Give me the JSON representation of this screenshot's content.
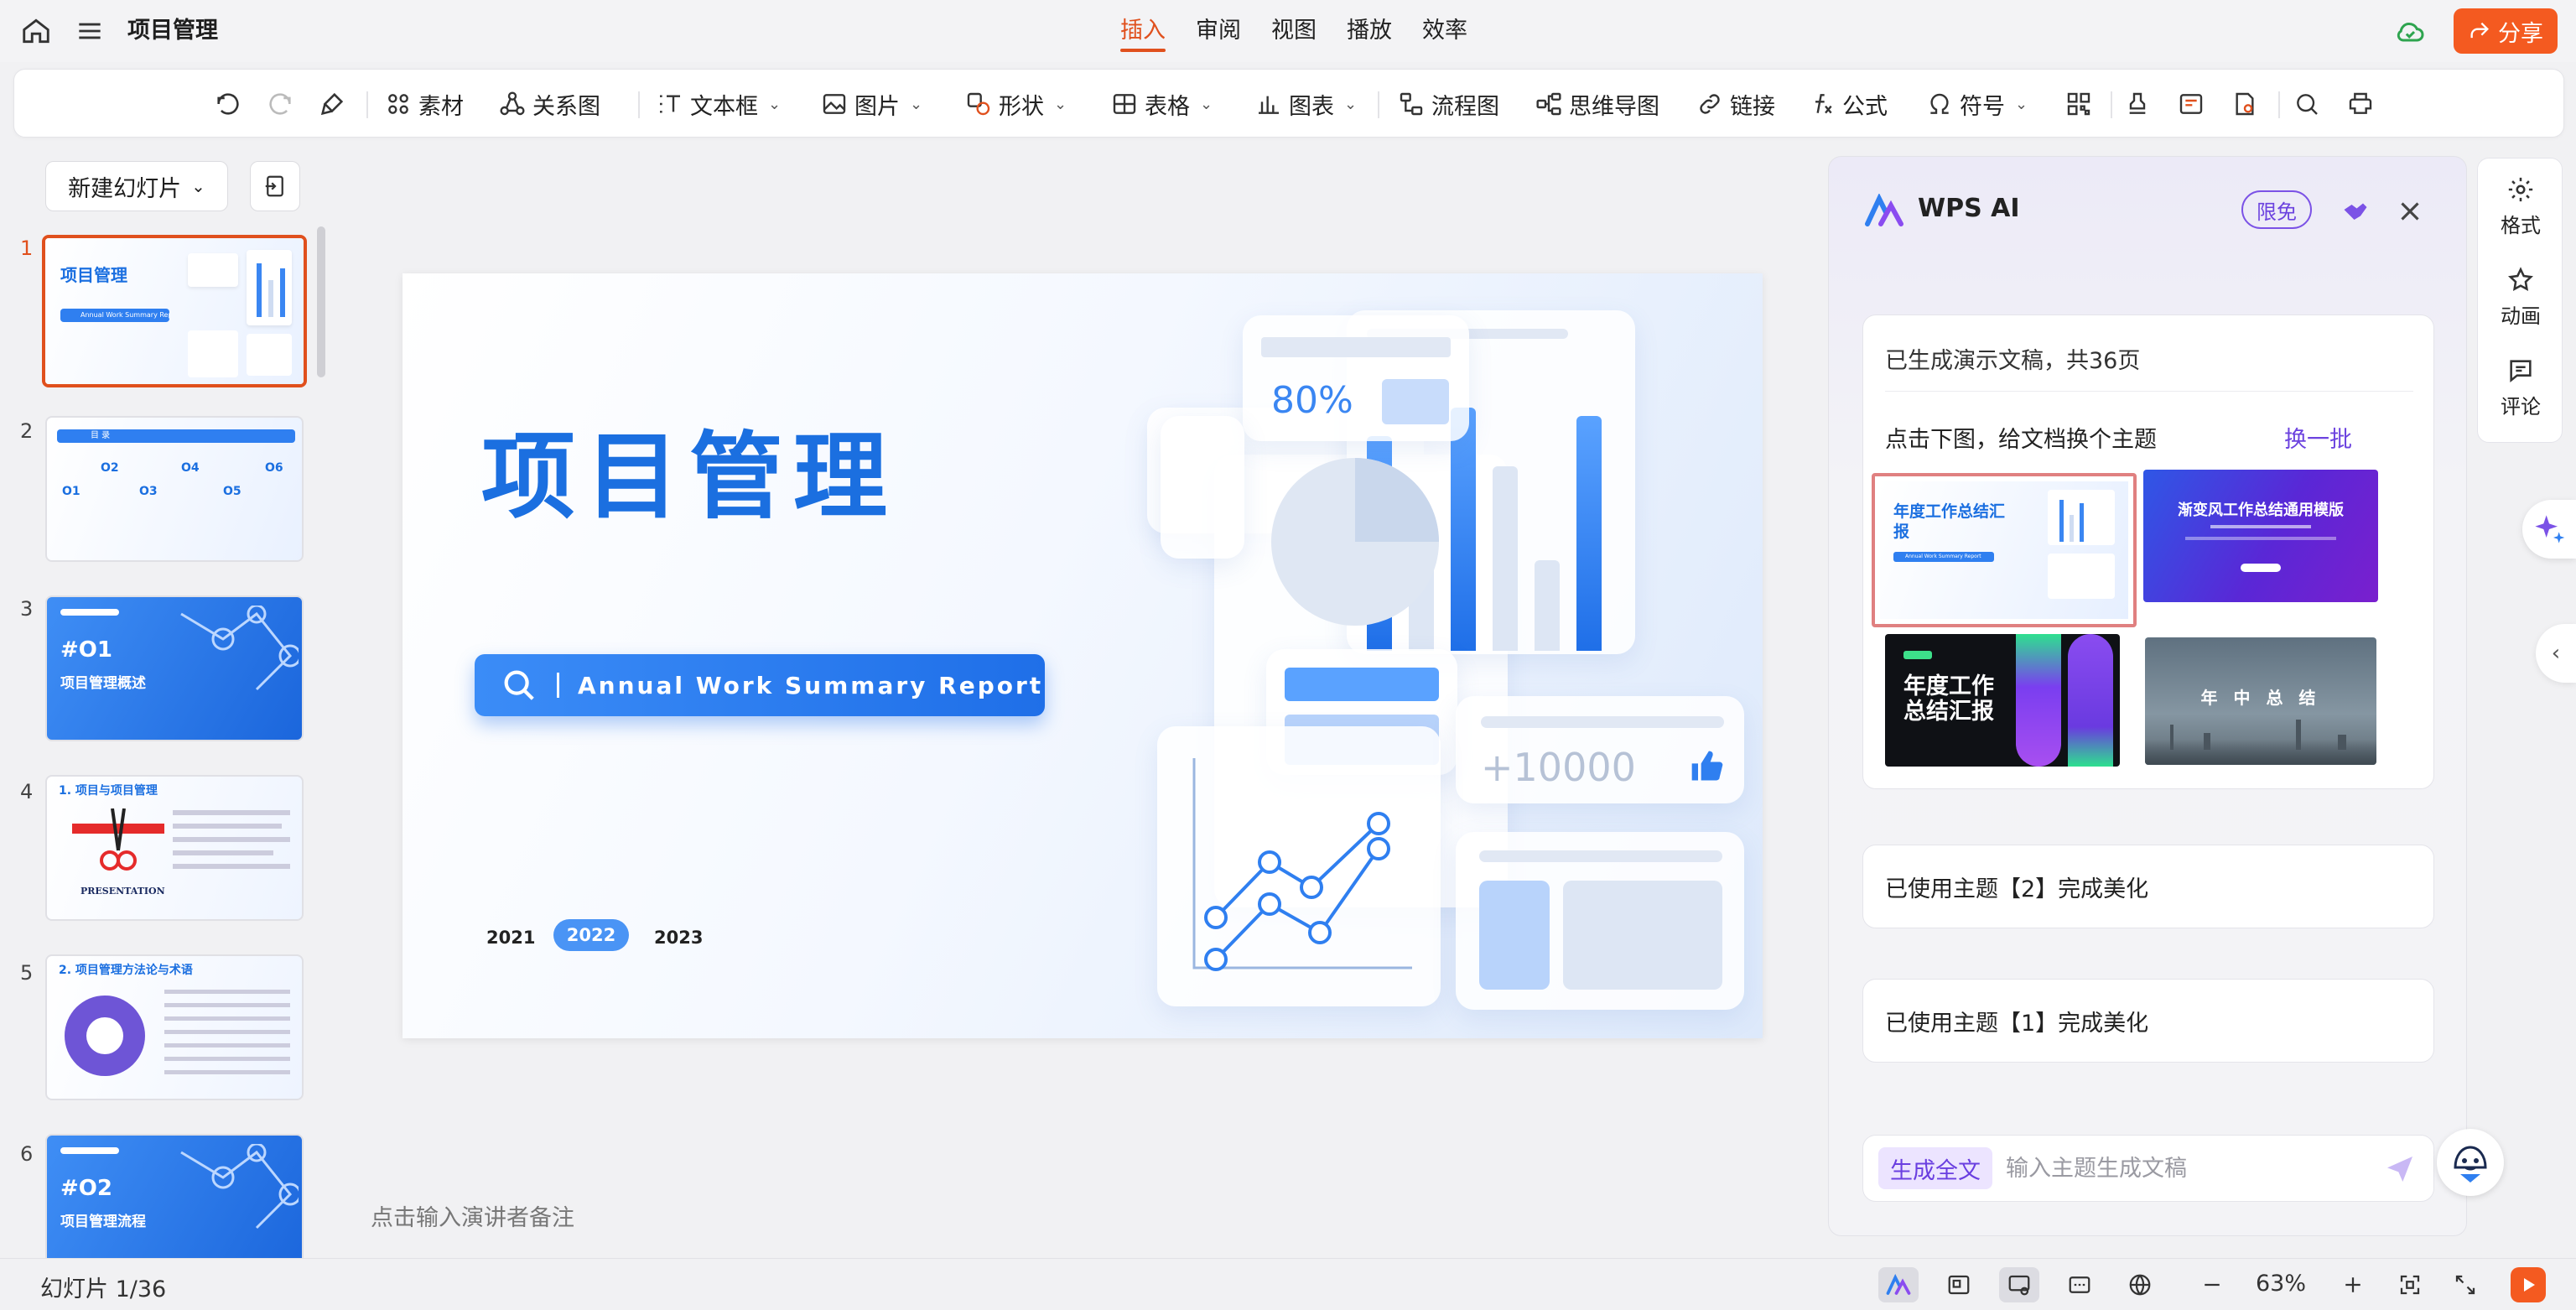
{
  "titlebar": {
    "doc_title": "项目管理",
    "tabs": [
      {
        "label": "插入",
        "active": true
      },
      {
        "label": "审阅",
        "active": false
      },
      {
        "label": "视图",
        "active": false
      },
      {
        "label": "播放",
        "active": false
      },
      {
        "label": "效率",
        "active": false
      }
    ],
    "share_label": "分享"
  },
  "ribbon": {
    "material": "素材",
    "relation": "关系图",
    "textbox": "文本框",
    "picture": "图片",
    "shape": "形状",
    "table": "表格",
    "chart": "图表",
    "flowchart": "流程图",
    "mindmap": "思维导图",
    "link": "链接",
    "formula": "公式",
    "symbol": "符号"
  },
  "left_panel": {
    "new_slide_label": "新建幻灯片",
    "thumbs": [
      {
        "num": "1",
        "title": "项目管理",
        "subtitle": "Annual Work Summary Report"
      },
      {
        "num": "2",
        "title": "目 录",
        "items": [
          "O1",
          "O2",
          "O3",
          "O4",
          "O5",
          "O6"
        ]
      },
      {
        "num": "3",
        "title": "#O1",
        "subtitle": "项目管理概述"
      },
      {
        "num": "4",
        "title": "1. 项目与项目管理",
        "caption": "PRESENTATION"
      },
      {
        "num": "5",
        "title": "2. 项目管理方法论与术语"
      },
      {
        "num": "6",
        "title": "#O2",
        "subtitle": "项目管理流程"
      }
    ]
  },
  "slide": {
    "title": "项目管理",
    "subtitle": "Annual Work Summary Report",
    "years": [
      "2021",
      "2022",
      "2023"
    ],
    "stat_percent": "80%",
    "stat_count": "+10000"
  },
  "notes_placeholder": "点击输入演讲者备注",
  "ai_panel": {
    "title": "WPS AI",
    "badge": "限免",
    "status": "已生成演示文稿，共36页",
    "hint": "点击下图，给文档换个主题",
    "refresh": "换一批",
    "themes": [
      {
        "title": "年度工作总结汇报",
        "subtitle": "Annual Work Summary Report"
      },
      {
        "title": "渐变风工作总结通用模版"
      },
      {
        "title": "年度工作总结汇报"
      },
      {
        "title": "年 中 总 结"
      }
    ],
    "results": [
      "已使用主题【2】完成美化",
      "已使用主题【1】完成美化"
    ],
    "generate_label": "生成全文",
    "input_placeholder": "输入主题生成文稿"
  },
  "right_strip": {
    "format": "格式",
    "animation": "动画",
    "comment": "评论"
  },
  "statusbar": {
    "slide_counter": "幻灯片 1/36",
    "zoom": "63%"
  },
  "colors": {
    "accent": "#e0501d",
    "share": "#f45a20",
    "slide_blue": "#1b6fe0",
    "ai_purple": "#6c43df"
  }
}
